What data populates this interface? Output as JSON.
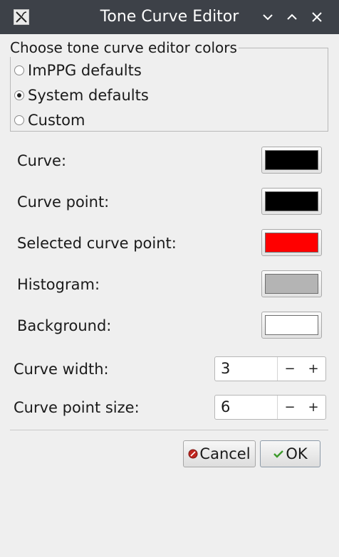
{
  "window": {
    "title": "Tone Curve Editor"
  },
  "group": {
    "title": "Choose tone curve editor colors",
    "options": [
      {
        "label": "ImPPG defaults",
        "selected": false
      },
      {
        "label": "System defaults",
        "selected": true
      },
      {
        "label": "Custom",
        "selected": false
      }
    ]
  },
  "colors": [
    {
      "label": "Curve:",
      "color": "#000000"
    },
    {
      "label": "Curve point:",
      "color": "#000000"
    },
    {
      "label": "Selected curve point:",
      "color": "#ff0000"
    },
    {
      "label": "Histogram:",
      "color": "#b4b4b4"
    },
    {
      "label": "Background:",
      "color": "#ffffff"
    }
  ],
  "spinners": [
    {
      "label": "Curve width:",
      "value": "3",
      "minus": "−",
      "plus": "+"
    },
    {
      "label": "Curve point size:",
      "value": "6",
      "minus": "−",
      "plus": "+"
    }
  ],
  "buttons": {
    "cancel_label": "Cancel",
    "ok_label": "OK"
  },
  "icons": {
    "app": "impp-logo-icon",
    "minimize": "chevron-down-icon",
    "maximize": "chevron-up-icon",
    "close": "close-icon",
    "cancel": "cancel-circle-icon",
    "ok": "checkmark-icon"
  }
}
